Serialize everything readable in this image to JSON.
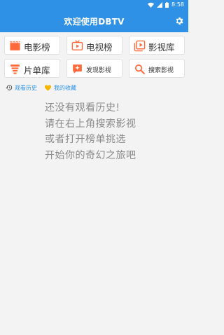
{
  "status": {
    "time": "8:58"
  },
  "appbar": {
    "title": "欢迎使用DBTV"
  },
  "buttons": [
    {
      "label": "电影榜",
      "icon": "movie-clapper-icon"
    },
    {
      "label": "电视榜",
      "icon": "tv-icon"
    },
    {
      "label": "影视库",
      "icon": "video-library-icon"
    },
    {
      "label": "片单库",
      "icon": "list-stack-icon"
    },
    {
      "label": "发现影视",
      "icon": "discover-sparkle-icon"
    },
    {
      "label": "搜索影视",
      "icon": "search-icon"
    }
  ],
  "tabs": [
    {
      "label": "观看历史",
      "icon": "history-icon"
    },
    {
      "label": "我的收藏",
      "icon": "heart-icon"
    }
  ],
  "empty_state": [
    "还没有观看历史!",
    "请在右上角搜索影视",
    "或者打开榜单挑选",
    "开始你的奇幻之旅吧"
  ],
  "colors": {
    "primary": "#2e91e6",
    "accent": "#ff6a3d",
    "favorite": "#f6b400"
  }
}
